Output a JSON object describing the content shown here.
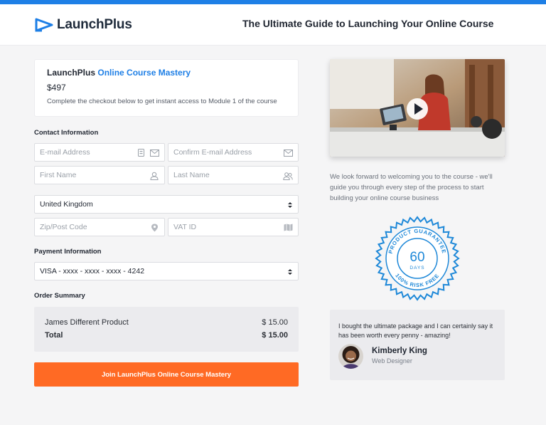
{
  "header": {
    "logo_text": "LaunchPlus",
    "title": "The Ultimate Guide to Launching Your Online Course",
    "accent_color": "#1e7fe6"
  },
  "product": {
    "brand": "LaunchPlus",
    "name": "Online Course Mastery",
    "price": "$497",
    "description": "Complete the checkout below to get instant access to Module 1 of the course"
  },
  "contact": {
    "label": "Contact Information",
    "email_placeholder": "E-mail Address",
    "confirm_email_placeholder": "Confirm E-mail Address",
    "first_name_placeholder": "First Name",
    "last_name_placeholder": "Last Name",
    "country_value": "United Kingdom",
    "zip_placeholder": "Zip/Post Code",
    "vat_placeholder": "VAT ID"
  },
  "payment": {
    "label": "Payment Information",
    "card_value": "VISA - xxxx - xxxx - xxxx - 4242"
  },
  "order": {
    "label": "Order Summary",
    "items": [
      {
        "name": "James Different Product",
        "price": "$ 15.00"
      }
    ],
    "total_label": "Total",
    "total_value": "$ 15.00"
  },
  "cta": {
    "label": "Join LaunchPlus Online Course Mastery",
    "color": "#ff6a24"
  },
  "welcome_text": "We look forward to welcoming you to the course - we'll guide you through every step of the process to start building your online course business",
  "badge": {
    "top_text": "PRODUCT GUARANTEE",
    "number": "60",
    "days": "DAYS",
    "bottom_text": "100% RISK FREE"
  },
  "testimonial": {
    "quote": "I bought the ultimate package and I can certainly say it has been worth every penny - amazing!",
    "name": "Kimberly King",
    "role": "Web Designer"
  }
}
